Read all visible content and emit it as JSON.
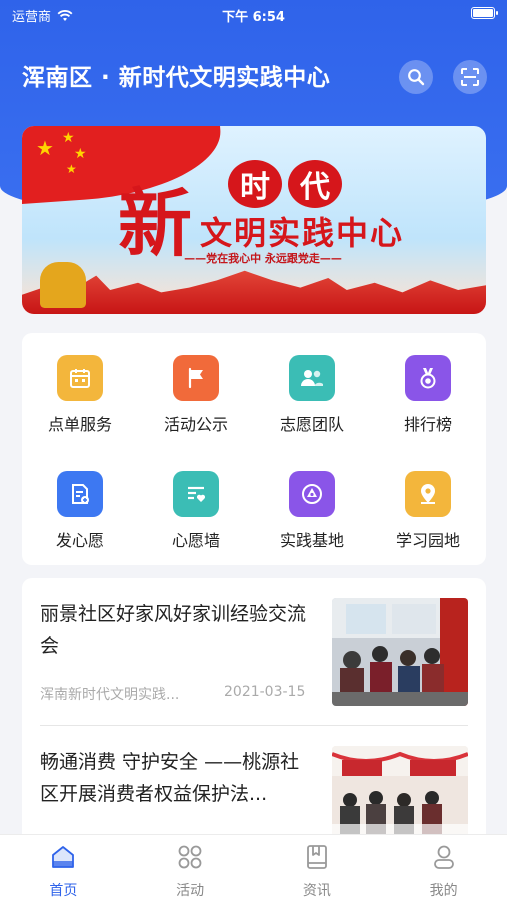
{
  "status_bar": {
    "carrier": "运营商",
    "time": "下午 6:54"
  },
  "header": {
    "title": "浑南区 · 新时代文明实践中心",
    "search_icon": "search-icon",
    "scan_icon": "scan-icon"
  },
  "banner": {
    "big_char": "新",
    "shidai": [
      "时",
      "代"
    ],
    "main_title": "文明实践中心",
    "sub_slogan": "——党在我心中  永远跟党走——"
  },
  "grid": {
    "items": [
      {
        "label": "点单服务",
        "icon": "calendar-icon",
        "color": "#f3b63c"
      },
      {
        "label": "活动公示",
        "icon": "flag-icon",
        "color": "#f16a3a"
      },
      {
        "label": "志愿团队",
        "icon": "people-icon",
        "color": "#3bbdb5"
      },
      {
        "label": "排行榜",
        "icon": "medal-icon",
        "color": "#8a55e8"
      },
      {
        "label": "发心愿",
        "icon": "document-add-icon",
        "color": "#3d78f2"
      },
      {
        "label": "心愿墙",
        "icon": "heart-list-icon",
        "color": "#3bbdb5"
      },
      {
        "label": "实践基地",
        "icon": "base-icon",
        "color": "#8a55e8"
      },
      {
        "label": "学习园地",
        "icon": "location-icon",
        "color": "#f3b63c"
      }
    ]
  },
  "news": [
    {
      "title": "丽景社区好家风好家训经验交流会",
      "source": "浑南新时代文明实践...",
      "date": "2021-03-15"
    },
    {
      "title": "畅通消费 守护安全 ——桃源社区开展消费者权益保护法...",
      "source": "",
      "date": ""
    }
  ],
  "tabs": [
    {
      "label": "首页",
      "icon": "home-icon",
      "active": true
    },
    {
      "label": "活动",
      "icon": "grid-icon",
      "active": false
    },
    {
      "label": "资讯",
      "icon": "book-icon",
      "active": false
    },
    {
      "label": "我的",
      "icon": "user-icon",
      "active": false
    }
  ],
  "colors": {
    "primary": "#2f63ea",
    "banner_red": "#d6161b"
  }
}
